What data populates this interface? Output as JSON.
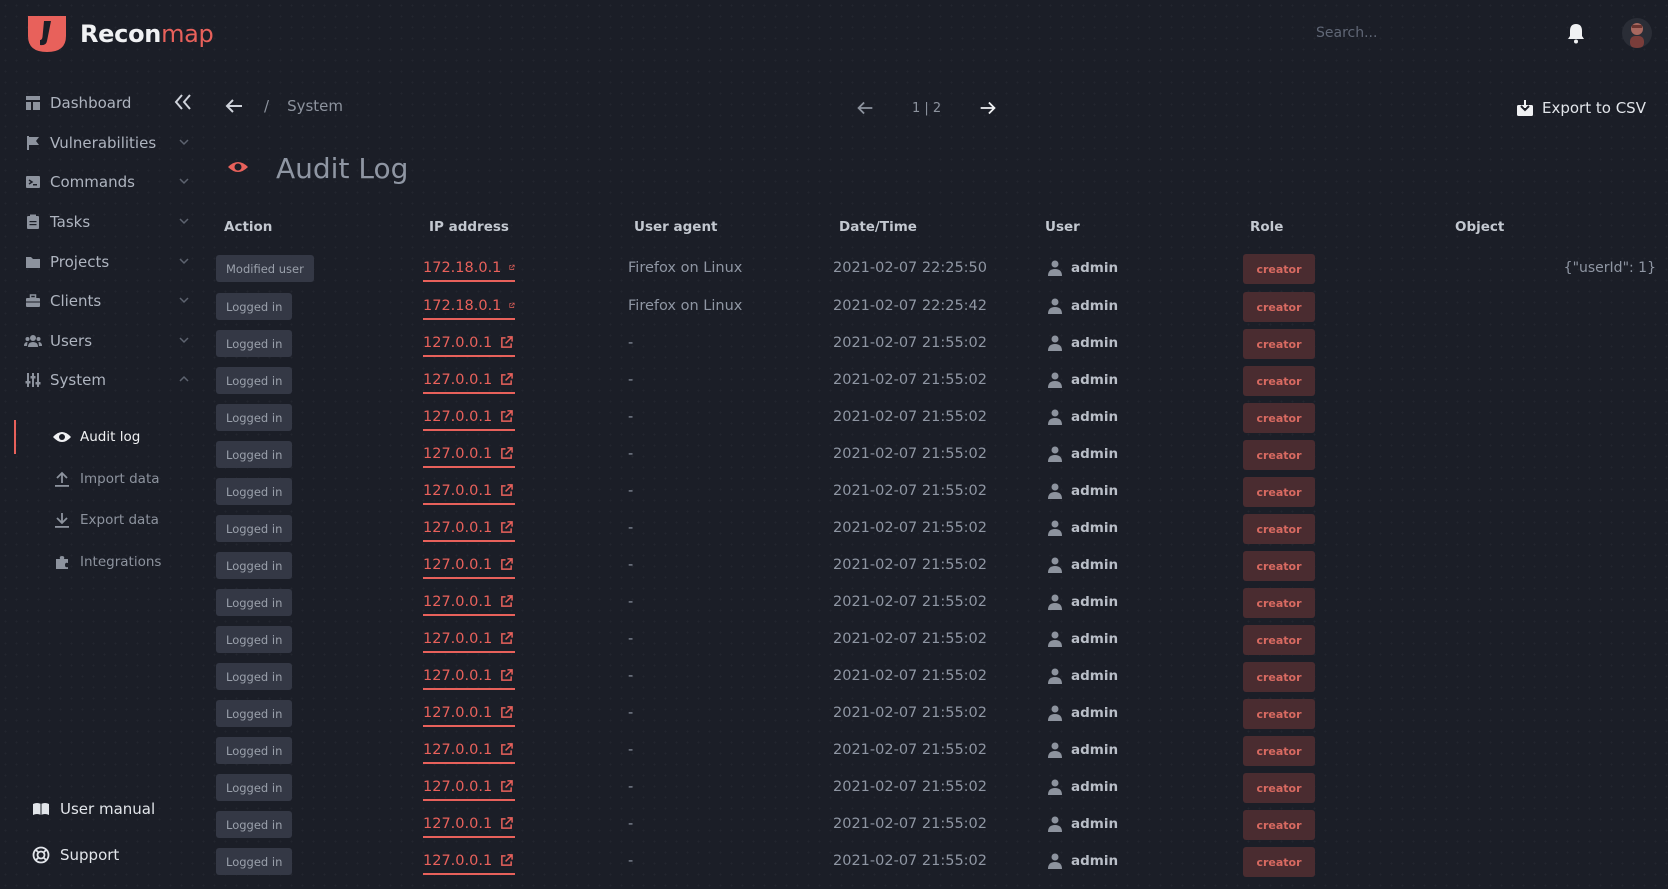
{
  "app": {
    "brand_main": "Recon",
    "brand_accent": "map",
    "accent_color": "#e8615b"
  },
  "header": {
    "search_placeholder": "Search..."
  },
  "sidebar": {
    "items": [
      {
        "label": "Dashboard",
        "icon": "dashboard-icon"
      },
      {
        "label": "Vulnerabilities",
        "icon": "flag-icon"
      },
      {
        "label": "Commands",
        "icon": "terminal-icon"
      },
      {
        "label": "Tasks",
        "icon": "clipboard-icon"
      },
      {
        "label": "Projects",
        "icon": "folder-icon"
      },
      {
        "label": "Clients",
        "icon": "briefcase-icon"
      },
      {
        "label": "Users",
        "icon": "users-icon"
      },
      {
        "label": "System",
        "icon": "sliders-icon"
      }
    ],
    "system_subitems": [
      {
        "label": "Audit log",
        "icon": "eye-icon"
      },
      {
        "label": "Import data",
        "icon": "upload-icon"
      },
      {
        "label": "Export data",
        "icon": "download-icon"
      },
      {
        "label": "Integrations",
        "icon": "puzzle-icon"
      }
    ],
    "footer": [
      {
        "label": "User manual",
        "icon": "book-icon"
      },
      {
        "label": "Support",
        "icon": "lifebuoy-icon"
      }
    ]
  },
  "breadcrumb": {
    "separator": "/",
    "current": "System"
  },
  "pagination": {
    "info": "1 | 2"
  },
  "toolbar": {
    "export_label": "Export to CSV"
  },
  "page": {
    "title": "Audit Log"
  },
  "table": {
    "headers": [
      "Action",
      "IP address",
      "User agent",
      "Date/Time",
      "User",
      "Role",
      "Object"
    ],
    "rows": [
      {
        "action": "Modified user",
        "ip": "172.18.0.1",
        "agent": "Firefox on Linux",
        "datetime": "2021-02-07 22:25:50",
        "user": "admin",
        "role": "creator",
        "object": "{\"userId\": 1}"
      },
      {
        "action": "Logged in",
        "ip": "172.18.0.1",
        "agent": "Firefox on Linux",
        "datetime": "2021-02-07 22:25:42",
        "user": "admin",
        "role": "creator",
        "object": ""
      },
      {
        "action": "Logged in",
        "ip": "127.0.0.1",
        "agent": "-",
        "datetime": "2021-02-07 21:55:02",
        "user": "admin",
        "role": "creator",
        "object": ""
      },
      {
        "action": "Logged in",
        "ip": "127.0.0.1",
        "agent": "-",
        "datetime": "2021-02-07 21:55:02",
        "user": "admin",
        "role": "creator",
        "object": ""
      },
      {
        "action": "Logged in",
        "ip": "127.0.0.1",
        "agent": "-",
        "datetime": "2021-02-07 21:55:02",
        "user": "admin",
        "role": "creator",
        "object": ""
      },
      {
        "action": "Logged in",
        "ip": "127.0.0.1",
        "agent": "-",
        "datetime": "2021-02-07 21:55:02",
        "user": "admin",
        "role": "creator",
        "object": ""
      },
      {
        "action": "Logged in",
        "ip": "127.0.0.1",
        "agent": "-",
        "datetime": "2021-02-07 21:55:02",
        "user": "admin",
        "role": "creator",
        "object": ""
      },
      {
        "action": "Logged in",
        "ip": "127.0.0.1",
        "agent": "-",
        "datetime": "2021-02-07 21:55:02",
        "user": "admin",
        "role": "creator",
        "object": ""
      },
      {
        "action": "Logged in",
        "ip": "127.0.0.1",
        "agent": "-",
        "datetime": "2021-02-07 21:55:02",
        "user": "admin",
        "role": "creator",
        "object": ""
      },
      {
        "action": "Logged in",
        "ip": "127.0.0.1",
        "agent": "-",
        "datetime": "2021-02-07 21:55:02",
        "user": "admin",
        "role": "creator",
        "object": ""
      },
      {
        "action": "Logged in",
        "ip": "127.0.0.1",
        "agent": "-",
        "datetime": "2021-02-07 21:55:02",
        "user": "admin",
        "role": "creator",
        "object": ""
      },
      {
        "action": "Logged in",
        "ip": "127.0.0.1",
        "agent": "-",
        "datetime": "2021-02-07 21:55:02",
        "user": "admin",
        "role": "creator",
        "object": ""
      },
      {
        "action": "Logged in",
        "ip": "127.0.0.1",
        "agent": "-",
        "datetime": "2021-02-07 21:55:02",
        "user": "admin",
        "role": "creator",
        "object": ""
      },
      {
        "action": "Logged in",
        "ip": "127.0.0.1",
        "agent": "-",
        "datetime": "2021-02-07 21:55:02",
        "user": "admin",
        "role": "creator",
        "object": ""
      },
      {
        "action": "Logged in",
        "ip": "127.0.0.1",
        "agent": "-",
        "datetime": "2021-02-07 21:55:02",
        "user": "admin",
        "role": "creator",
        "object": ""
      },
      {
        "action": "Logged in",
        "ip": "127.0.0.1",
        "agent": "-",
        "datetime": "2021-02-07 21:55:02",
        "user": "admin",
        "role": "creator",
        "object": ""
      },
      {
        "action": "Logged in",
        "ip": "127.0.0.1",
        "agent": "-",
        "datetime": "2021-02-07 21:55:02",
        "user": "admin",
        "role": "creator",
        "object": ""
      }
    ]
  }
}
